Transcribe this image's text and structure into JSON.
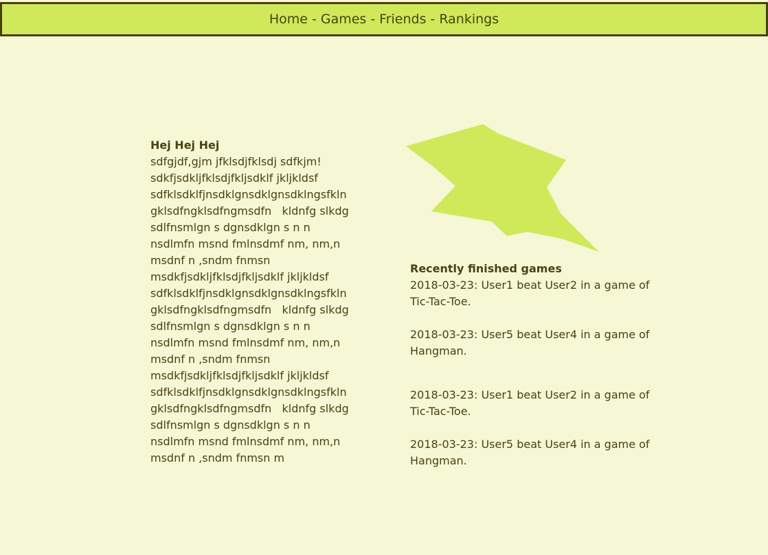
{
  "nav": {
    "items": [
      "Home",
      "Games",
      "Friends",
      "Rankings"
    ],
    "separator": "-"
  },
  "intro": {
    "title": "Hej Hej Hej",
    "lines": [
      "sdfgjdf,gjm jfklsdjfklsdj sdfkjm!",
      "sdkfjsdkljfklsdjfkljsdklf jkljkldsf",
      "sdfklsdklfjnsdklgnsdklgnsdklngsfkln",
      "gklsdfngklsdfngmsdfn   kldnfg slkdg",
      "sdlfnsmlgn s dgnsdklgn s n n",
      "nsdlmfn msnd fmlnsdmf nm, nm,n",
      "msdnf n ,sndm fnmsn",
      "msdkfjsdkljfklsdjfkljsdklf jkljkldsf",
      "sdfklsdklfjnsdklgnsdklgnsdklngsfkln",
      "gklsdfngklsdfngmsdfn   kldnfg slkdg",
      "sdlfnsmlgn s dgnsdklgn s n n",
      "nsdlmfn msnd fmlnsdmf nm, nm,n",
      "msdnf n ,sndm fnmsn",
      "msdkfjsdkljfklsdjfkljsdklf jkljkldsf",
      "sdfklsdklfjnsdklgnsdklgnsdklngsfkln",
      "gklsdfngklsdfngmsdfn   kldnfg slkdg",
      "sdlfnsmlgn s dgnsdklgn s n n",
      "nsdlmfn msnd fmlnsdmf nm, nm,n",
      "msdnf n ,sndm fnmsn m"
    ]
  },
  "recent": {
    "title": "Recently finished games",
    "entries": [
      {
        "line1": "2018-03-23: User1 beat User2 in a game of",
        "line2": "Tic-Tac-Toe."
      },
      {
        "line1": "2018-03-23: User5 beat User4 in a game of",
        "line2": "Hangman."
      },
      {
        "line1": "2018-03-23: User1 beat User2 in a game of",
        "line2": "Tic-Tac-Toe."
      },
      {
        "line1": "2018-03-23: User5 beat User4 in a game of",
        "line2": "Hangman."
      }
    ]
  },
  "colors": {
    "background": "#f5f7d5",
    "accent": "#cfe95a",
    "border": "#4b3e0e",
    "text": "#4a4212"
  },
  "logo": {
    "icon": "star-logo-icon"
  }
}
